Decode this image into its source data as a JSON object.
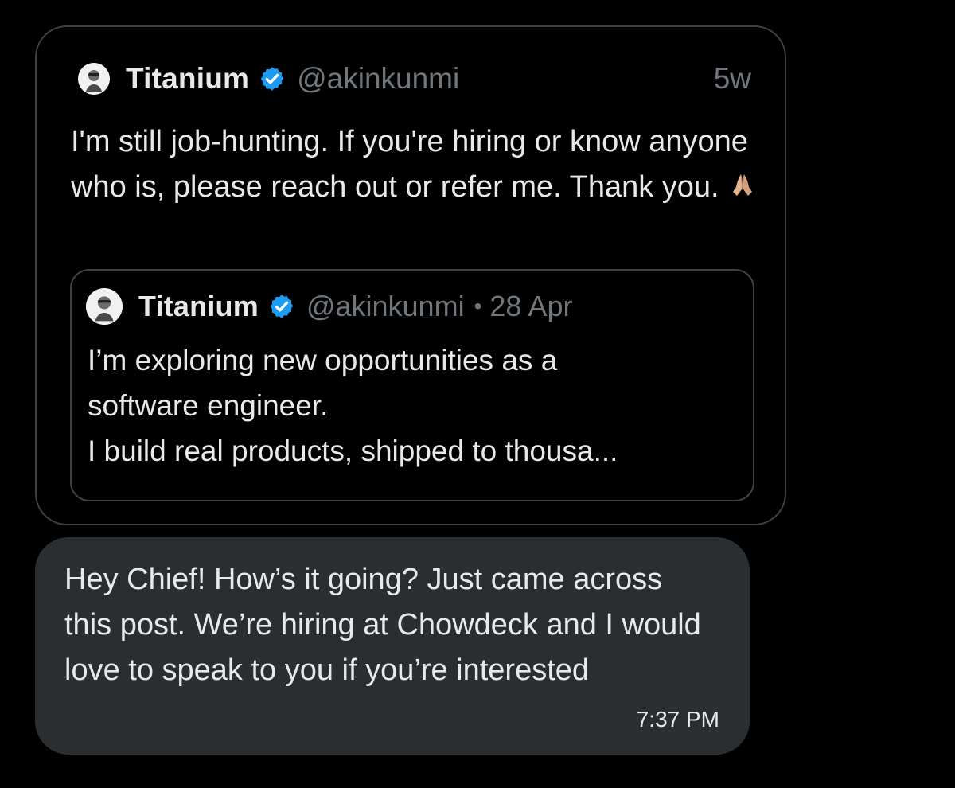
{
  "shared_post": {
    "author": {
      "name": "Titanium",
      "handle": "@akinkunmi",
      "verified": true,
      "avatar_icon": "avatar-photo-icon"
    },
    "age": "5w",
    "text": "I'm still job-hunting. If you're hiring or know anyone who is, please reach out or refer me. Thank you.",
    "emoji": "folded-hands",
    "quoted_post": {
      "author": {
        "name": "Titanium",
        "handle": "@akinkunmi",
        "verified": true,
        "avatar_icon": "avatar-photo-icon"
      },
      "separator": "•",
      "date": "28 Apr",
      "text": "I’m exploring new opportunities as a\nsoftware engineer.\nI build real products, shipped to thousa..."
    }
  },
  "message": {
    "text": "Hey Chief! How’s it going? Just came across this post. We’re hiring at Chowdeck and I would love to speak to you if you’re interested",
    "time": "7:37 PM"
  },
  "colors": {
    "background": "#000000",
    "text": "#e7e9ea",
    "muted": "#71767b",
    "border": "#3e4144",
    "bubble": "#2b2e31",
    "verified": "#1d9bf0"
  }
}
